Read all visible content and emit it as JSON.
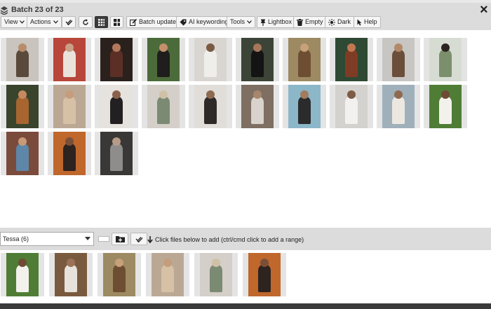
{
  "window": {
    "title": "Batch 23 of 23",
    "close_symbol": "×"
  },
  "toolbar": {
    "view": "View",
    "actions": "Actions",
    "batch_update": "Batch update",
    "ai_keywording": "AI keywording",
    "tools": "Tools",
    "lightbox": "Lightbox",
    "empty": "Empty",
    "dark": "Dark",
    "help": "Help"
  },
  "grid": {
    "rows": [
      [
        {
          "bg": "#c9c4bd",
          "fig": "#5a4a3c",
          "head": "#b78d6d"
        },
        {
          "bg": "#b8463a",
          "fig": "#e9e3dc",
          "head": "#c9a086"
        },
        {
          "bg": "#2a211d",
          "fig": "#5b2f26",
          "head": "#b3785b"
        },
        {
          "bg": "#4c6b3a",
          "fig": "#1f1d1d",
          "head": "#c58f6c"
        },
        {
          "bg": "#d9d6d1",
          "fig": "#f0eeea",
          "head": "#7b5a43"
        },
        {
          "bg": "#3b4436",
          "fig": "#141414",
          "head": "#a6775a"
        },
        {
          "bg": "#9d8a62",
          "fig": "#6d4e32",
          "head": "#c8a07a"
        },
        {
          "bg": "#2f4a34",
          "fig": "#7f3c25",
          "head": "#c07752"
        },
        {
          "bg": "#c8c6c3",
          "fig": "#6b4f3b",
          "head": "#b3896a"
        },
        {
          "bg": "#d7dcd3",
          "fig": "#7b8f6c",
          "head": "#2b2422"
        }
      ],
      [
        {
          "bg": "#3a442c",
          "fig": "#a8652f",
          "head": "#c78a60"
        },
        {
          "bg": "#bba894",
          "fig": "#d7c1a6",
          "head": "#c59d7c"
        },
        {
          "bg": "#e6e2de",
          "fig": "#222020",
          "head": "#8b614b"
        },
        {
          "bg": "#d4cfc8",
          "fig": "#7b8a73",
          "head": "#cfc1a8"
        },
        {
          "bg": "#e1ded9",
          "fig": "#2d2a28",
          "head": "#8d6a50"
        },
        {
          "bg": "#7e6f62",
          "fig": "#d8d3cc",
          "head": "#a7866b"
        },
        {
          "bg": "#8bb7c9",
          "fig": "#2b2b2b",
          "head": "#a37b5e"
        },
        {
          "bg": "#d4d2cf",
          "fig": "#f2f1ef",
          "head": "#7d5b45"
        },
        {
          "bg": "#9fb0bb",
          "fig": "#ece8e1",
          "head": "#8f6a50"
        },
        {
          "bg": "#4f7d35",
          "fig": "#f3f1ec",
          "head": "#6f4a35"
        }
      ],
      [
        {
          "bg": "#7a4b3b",
          "fig": "#5d86a8",
          "head": "#c89a78"
        },
        {
          "bg": "#c0672c",
          "fig": "#2d231f",
          "head": "#7a4f38"
        },
        {
          "bg": "#3a3836",
          "fig": "#8f8d8b",
          "head": "#b89b86"
        }
      ]
    ]
  },
  "bottombar": {
    "collection_value": "Tessa (6)",
    "hint": "Click files below to add (ctrl/cmd click to add a range)"
  },
  "selected": [
    {
      "bg": "#4f7d35",
      "fig": "#f3f1ec",
      "head": "#6f4a35"
    },
    {
      "bg": "#7a5a3f",
      "fig": "#e7e2db",
      "head": "#9b7257"
    },
    {
      "bg": "#9d8a62",
      "fig": "#6d4e32",
      "head": "#c8a07a"
    },
    {
      "bg": "#bba894",
      "fig": "#d7c1a6",
      "head": "#c59d7c"
    },
    {
      "bg": "#d4cfc8",
      "fig": "#7b8a73",
      "head": "#cfc1a8"
    },
    {
      "bg": "#c0672c",
      "fig": "#2d231f",
      "head": "#7a4f38"
    }
  ]
}
